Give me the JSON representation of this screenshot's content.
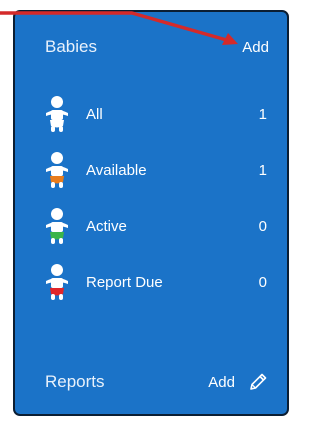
{
  "babies": {
    "title": "Babies",
    "add_label": "Add",
    "items": [
      {
        "label": "All",
        "count": "1",
        "icon": "baby-icon",
        "diaper_color": "#ffffff"
      },
      {
        "label": "Available",
        "count": "1",
        "icon": "baby-icon",
        "diaper_color": "#e87c1c"
      },
      {
        "label": "Active",
        "count": "0",
        "icon": "baby-icon",
        "diaper_color": "#3bb54a"
      },
      {
        "label": "Report Due",
        "count": "0",
        "icon": "baby-icon",
        "diaper_color": "#e0262b"
      }
    ]
  },
  "reports": {
    "title": "Reports",
    "add_label": "Add",
    "edit_icon": "pencil-icon"
  },
  "colors": {
    "panel_background": "#1b73c8",
    "panel_border": "#0b1e33",
    "annotation_arrow": "#d42a2a"
  }
}
